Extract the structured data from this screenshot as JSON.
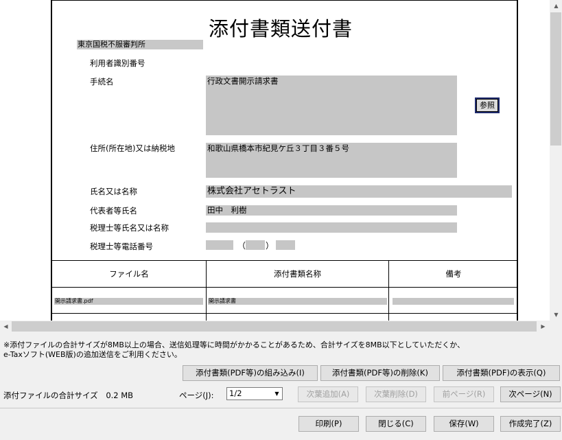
{
  "document": {
    "title": "添付書類送付書",
    "office": "東京国税不服審判所",
    "labels": {
      "user_id": "利用者識別番号",
      "procedure": "手続名",
      "address": "住所(所在地)又は納税地",
      "name": "氏名又は名称",
      "representative": "代表者等氏名",
      "tax_accountant": "税理士等氏名又は名称",
      "tax_accountant_phone": "税理士等電話番号"
    },
    "values": {
      "user_id": "",
      "procedure": "行政文書開示請求書",
      "address": "和歌山県橋本市紀見ケ丘３丁目３番５号",
      "name": "株式会社アセトラスト",
      "representative": "田中　利樹",
      "tax_accountant": "",
      "phone_open": "（",
      "phone_close": "）"
    },
    "reference_button": "参照",
    "file_table": {
      "headers": [
        "ファイル名",
        "添付書類名称",
        "備考"
      ],
      "rows": [
        {
          "file_name": "開示請求書.pdf",
          "attachment_name": "開示請求書",
          "note": ""
        }
      ]
    }
  },
  "bottom": {
    "notice_line1": "※添付ファイルの合計サイズが8MB以上の場合、送信処理等に時間がかかることがあるため、合計サイズを8MB以下としていただくか、",
    "notice_line2": "e-Taxソフト(WEB版)の追加送信をご利用ください。",
    "buttons_row1": {
      "embed": "添付書類(PDF等)の組み込み(I)",
      "delete": "添付書類(PDF等)の削除(K)",
      "show": "添付書類(PDF)の表示(Q)"
    },
    "total_size_label": "添付ファイルの合計サイズ",
    "total_size_value": "0.2 MB",
    "page_label": "ページ(J):",
    "page_value": "1/2",
    "buttons_row2": {
      "add_next": "次葉追加(A)",
      "delete_next": "次葉削除(D)",
      "prev_page": "前ページ(R)",
      "next_page": "次ページ(N)"
    },
    "buttons_row3": {
      "print": "印刷(P)",
      "close": "閉じる(C)",
      "save": "保存(W)",
      "complete": "作成完了(Z)"
    }
  },
  "icons": {
    "scroll_up": "up-arrow-icon",
    "scroll_down": "down-arrow-icon",
    "scroll_left": "left-arrow-icon",
    "scroll_right": "right-arrow-icon",
    "dropdown": "chevron-down-icon"
  },
  "colors": {
    "field_gray": "#c6c6c6",
    "reference_button_frame": "#1f2b6e"
  }
}
